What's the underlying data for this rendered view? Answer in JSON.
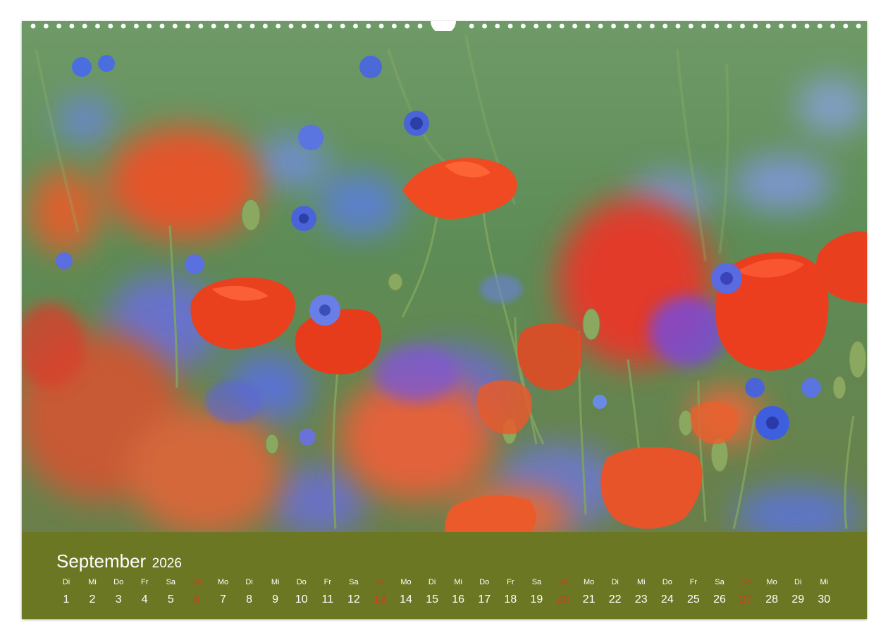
{
  "calendar": {
    "month": "September",
    "year": "2026",
    "days": [
      {
        "wd": "Di",
        "d": "1"
      },
      {
        "wd": "Mi",
        "d": "2"
      },
      {
        "wd": "Do",
        "d": "3"
      },
      {
        "wd": "Fr",
        "d": "4"
      },
      {
        "wd": "Sa",
        "d": "5"
      },
      {
        "wd": "So",
        "d": "6",
        "sunday": true
      },
      {
        "wd": "Mo",
        "d": "7"
      },
      {
        "wd": "Di",
        "d": "8"
      },
      {
        "wd": "Mi",
        "d": "9"
      },
      {
        "wd": "Do",
        "d": "10"
      },
      {
        "wd": "Fr",
        "d": "11"
      },
      {
        "wd": "Sa",
        "d": "12"
      },
      {
        "wd": "So",
        "d": "13",
        "sunday": true
      },
      {
        "wd": "Mo",
        "d": "14"
      },
      {
        "wd": "Di",
        "d": "15"
      },
      {
        "wd": "Mi",
        "d": "16"
      },
      {
        "wd": "Do",
        "d": "17"
      },
      {
        "wd": "Fr",
        "d": "18"
      },
      {
        "wd": "Sa",
        "d": "19"
      },
      {
        "wd": "So",
        "d": "20",
        "sunday": true
      },
      {
        "wd": "Mo",
        "d": "21"
      },
      {
        "wd": "Di",
        "d": "22"
      },
      {
        "wd": "Mi",
        "d": "23"
      },
      {
        "wd": "Do",
        "d": "24"
      },
      {
        "wd": "Fr",
        "d": "25"
      },
      {
        "wd": "Sa",
        "d": "26"
      },
      {
        "wd": "So",
        "d": "27",
        "sunday": true
      },
      {
        "wd": "Mo",
        "d": "28"
      },
      {
        "wd": "Di",
        "d": "29"
      },
      {
        "wd": "Mi",
        "d": "30"
      }
    ]
  },
  "colors": {
    "calendar_band": "#6c7724",
    "text": "#ffffff",
    "sunday": "#d93a1c",
    "poppy": "#e8401c",
    "cornflower": "#4a64d8",
    "meadow": "#5f8a55"
  },
  "photo": {
    "subject": "poppy-cornflower-meadow"
  }
}
